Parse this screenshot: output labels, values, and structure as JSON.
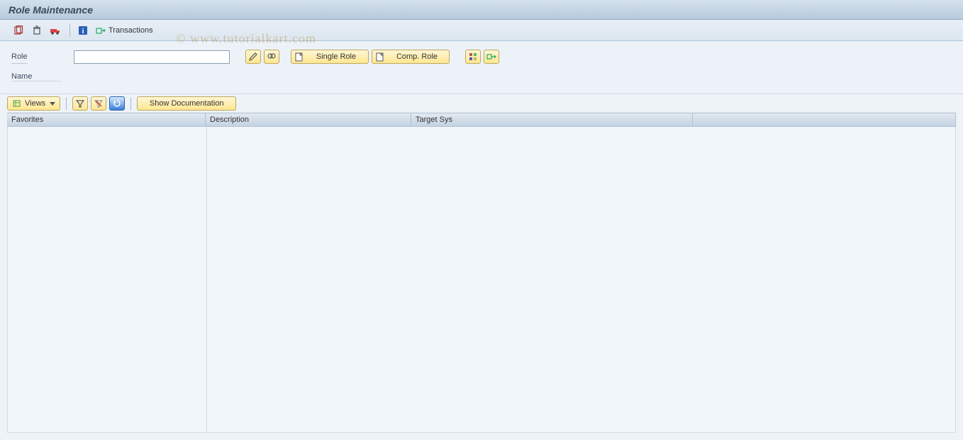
{
  "title": "Role Maintenance",
  "watermark": "© www.tutorialkart.com",
  "toolbar": {
    "transactions_label": "Transactions"
  },
  "form": {
    "role_label": "Role",
    "role_value": "",
    "name_label": "Name",
    "name_value": "",
    "single_role_label": "Single Role",
    "comp_role_label": "Comp. Role"
  },
  "grid_toolbar": {
    "views_label": "Views",
    "show_doc_label": "Show Documentation"
  },
  "grid": {
    "headers": {
      "favorites": "Favorites",
      "description": "Description",
      "target_sys": "Target Sys"
    },
    "rows": []
  }
}
